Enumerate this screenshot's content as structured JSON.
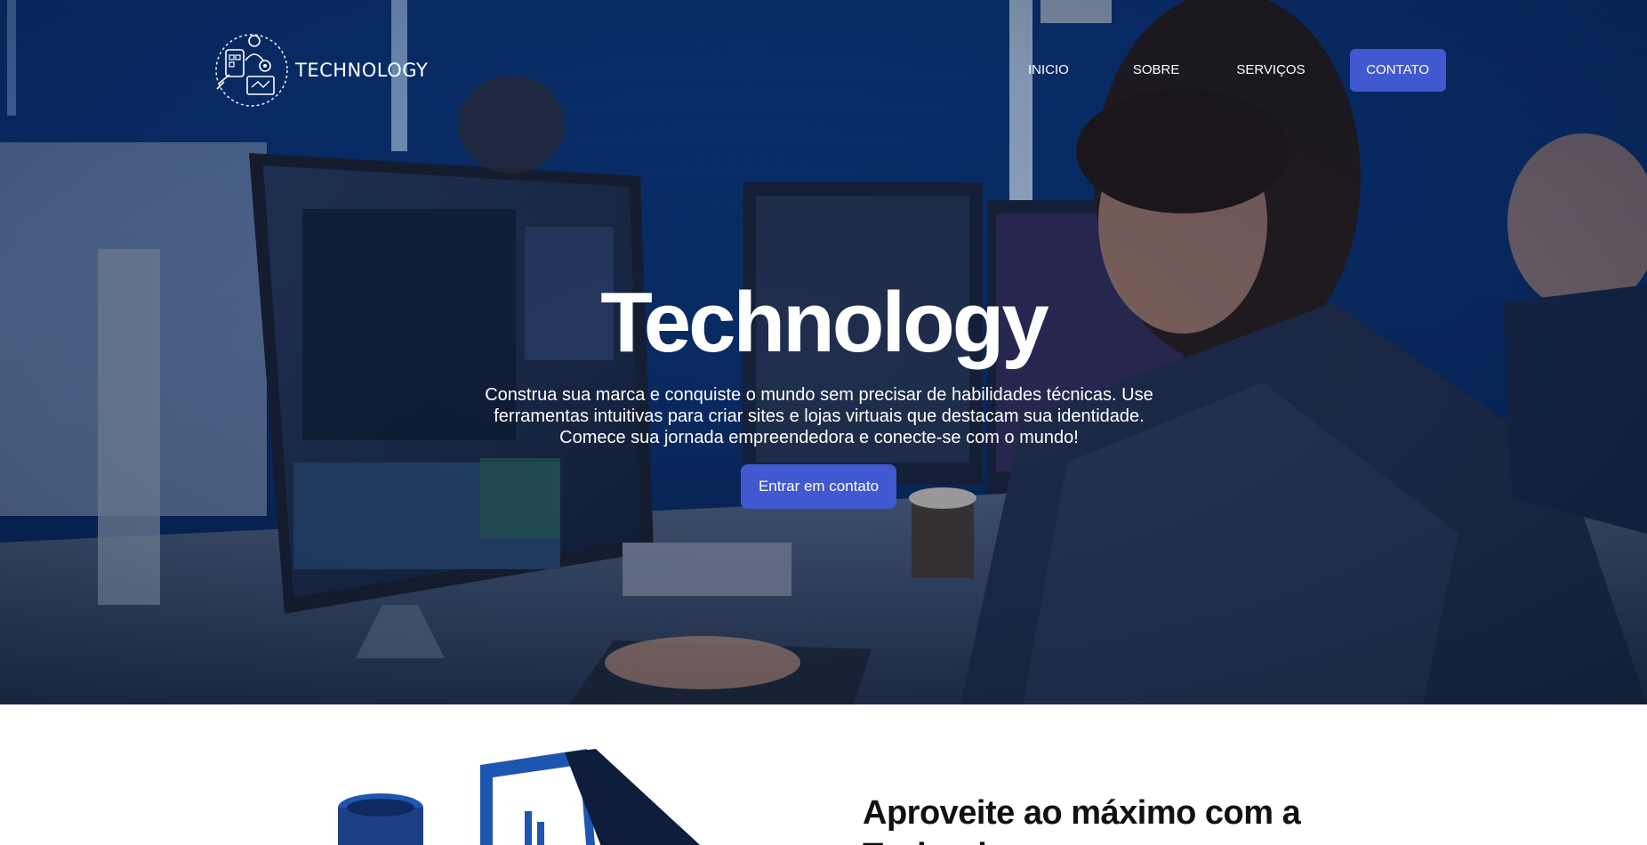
{
  "nav": {
    "brand": "TECHNOLOGY",
    "links": [
      "INICIO",
      "SOBRE",
      "SERVIÇOS"
    ],
    "cta": "CONTATO"
  },
  "hero": {
    "title": "Technology",
    "description": "Construa sua marca e conquiste o mundo sem precisar de habilidades técnicas. Use ferramentas intuitivas para criar sites e lojas virtuais que destacam sua identidade. Comece sua jornada empreendedora e conecte-se com o mundo!",
    "button": "Entrar em contato"
  },
  "section2": {
    "title": "Aproveite ao máximo com a Technology"
  },
  "colors": {
    "accent": "#4058d0",
    "hero_bg": "#0b3470"
  }
}
